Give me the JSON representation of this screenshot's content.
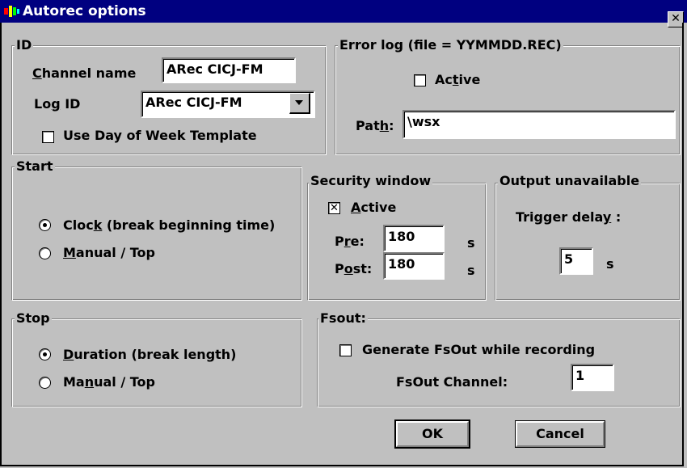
{
  "window": {
    "title": "Autorec options",
    "close_glyph": "✕"
  },
  "id_group": {
    "legend": "ID",
    "channel_name_label": "Channel name",
    "channel_name_value": "ARec CICJ-FM",
    "log_id_label": "Log ID",
    "log_id_value": "ARec CICJ-FM",
    "day_of_week_label": "Use Day of Week Template",
    "day_of_week_checked": false
  },
  "error_log": {
    "legend": "Error log (file = YYMMDD.REC)",
    "active_label": "Active",
    "active_checked": false,
    "path_label": "Path:",
    "path_value": "\\wsx"
  },
  "start": {
    "legend": "Start",
    "options": [
      {
        "label": "Clock (break beginning time)",
        "selected": true
      },
      {
        "label": "Manual / Top",
        "selected": false
      }
    ]
  },
  "security_window": {
    "legend": "Security window",
    "active_label": "Active",
    "active_checked": true,
    "active_mark": "✕",
    "pre_label": "Pre:",
    "pre_value": "180",
    "pre_unit": "s",
    "post_label": "Post:",
    "post_value": "180",
    "post_unit": "s"
  },
  "output_unavailable": {
    "legend": "Output unavailable",
    "trigger_delay_label": "Trigger delay :",
    "trigger_delay_value": "5",
    "unit": "s"
  },
  "stop": {
    "legend": "Stop",
    "options": [
      {
        "label": "Duration (break length)",
        "selected": true
      },
      {
        "label": "Manual / Top",
        "selected": false
      }
    ]
  },
  "fsout": {
    "legend": "Fsout:",
    "generate_label": "Generate FsOut while recording",
    "generate_checked": false,
    "channel_label": "FsOut Channel:",
    "channel_value": "1"
  },
  "buttons": {
    "ok": "OK",
    "cancel": "Cancel"
  },
  "icons": {
    "app": "app-icon",
    "close": "close-icon",
    "dropdown": "chevron-down-icon"
  },
  "colors": {
    "face": "#c0c0c0",
    "titlebar": "#000080",
    "field": "#ffffff"
  }
}
